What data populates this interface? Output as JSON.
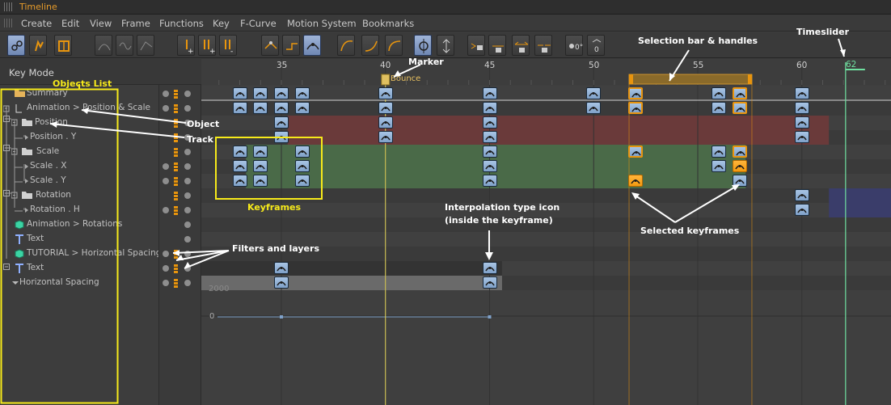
{
  "window": {
    "title": "Timeline"
  },
  "menu": [
    "Create",
    "Edit",
    "View",
    "Frame",
    "Functions",
    "Key",
    "F-Curve",
    "Motion System",
    "Bookmarks"
  ],
  "header": {
    "key_mode": "Key Mode"
  },
  "ruler": {
    "labels": [
      "35",
      "40",
      "45",
      "50",
      "55",
      "60"
    ],
    "current_frame": "62"
  },
  "marker": {
    "label": "Bounce"
  },
  "tree": [
    {
      "label": "Summary",
      "icon": "folder-icon"
    },
    {
      "label": "Animation > Position & Scale",
      "icon": "null-object-icon"
    },
    {
      "label": "Position",
      "icon": "folder-icon"
    },
    {
      "label": "Position . Y",
      "icon": "track-icon"
    },
    {
      "label": "Scale",
      "icon": "folder-icon"
    },
    {
      "label": "Scale . X",
      "icon": "track-icon"
    },
    {
      "label": "Scale . Y",
      "icon": "track-icon"
    },
    {
      "label": "Rotation",
      "icon": "folder-icon"
    },
    {
      "label": "Rotation . H",
      "icon": "track-icon"
    },
    {
      "label": "Animation > Rotations",
      "icon": "cube-icon"
    },
    {
      "label": "Text",
      "icon": "text-icon"
    },
    {
      "label": "TUTORIAL > Horizontal Spacing",
      "icon": "cube-icon"
    },
    {
      "label": "Text",
      "icon": "text-icon"
    },
    {
      "label": "Horizontal Spacing",
      "icon": "track-icon"
    }
  ],
  "curve": {
    "value_labels": [
      "2000",
      "0"
    ]
  },
  "annotations": {
    "objects_list": "Objects List",
    "object": "Object",
    "track": "Track",
    "keyframes": "Keyframes",
    "filters_layers": "Filters and layers",
    "marker": "Marker",
    "selection_bar": "Selection bar & handles",
    "timeslider": "Timeslider",
    "interp_line1": "Interpolation type icon",
    "interp_line2": "(inside the keyframe)",
    "selected_keyframes": "Selected keyframes"
  },
  "colors": {
    "accent_orange": "#e8940e",
    "title_orange": "#e49a2a",
    "track_red": "#6a3a3a",
    "track_green": "#4a6a48",
    "track_blue": "#3a3d6a",
    "timeslider_green": "#6fe0a0",
    "annotation_yellow": "#f7ea1a",
    "keyframe_blue": "#8fb0d6"
  }
}
